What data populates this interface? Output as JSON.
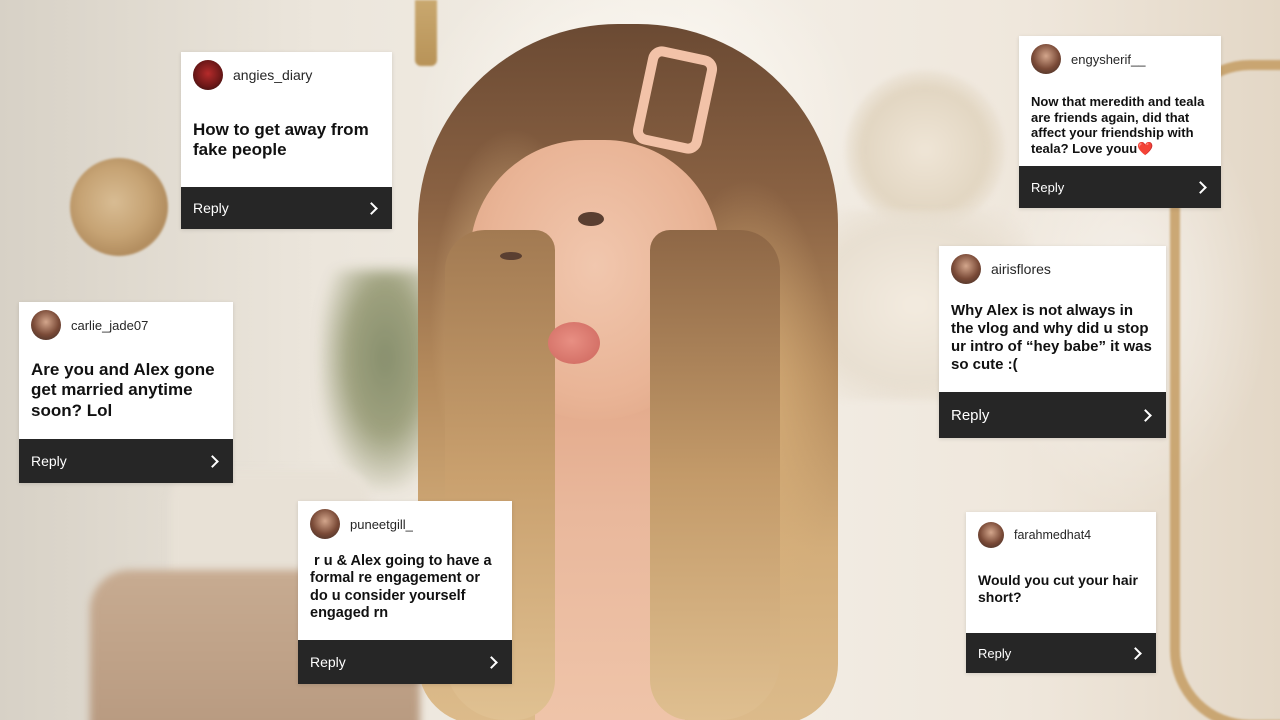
{
  "cards": [
    {
      "username": "angies_diary",
      "question": "How to get away from fake people",
      "reply": "Reply"
    },
    {
      "username": "engysherif__",
      "question": "Now that meredith and teala are friends again, did that affect your friendship with teala? Love youu❤️",
      "reply": "Reply"
    },
    {
      "username": "carlie_jade07",
      "question": "Are you and Alex gone get married anytime soon? Lol",
      "reply": "Reply"
    },
    {
      "username": "airisflores",
      "question": "Why Alex is not always in the vlog and why did u stop ur intro of “hey babe” it was so cute :(",
      "reply": "Reply"
    },
    {
      "username": "puneetgill_",
      "question": " r u & Alex going to have a formal re engagement or do u consider yourself engaged rn",
      "reply": "Reply"
    },
    {
      "username": "farahmedhat4",
      "question": "Would you cut your hair short?",
      "reply": "Reply"
    }
  ],
  "colors": {
    "card_bg": "#ffffff",
    "reply_bar": "#262626",
    "question_text": "#111111"
  },
  "icons": {
    "reply_arrow": "chevron-right-icon"
  }
}
